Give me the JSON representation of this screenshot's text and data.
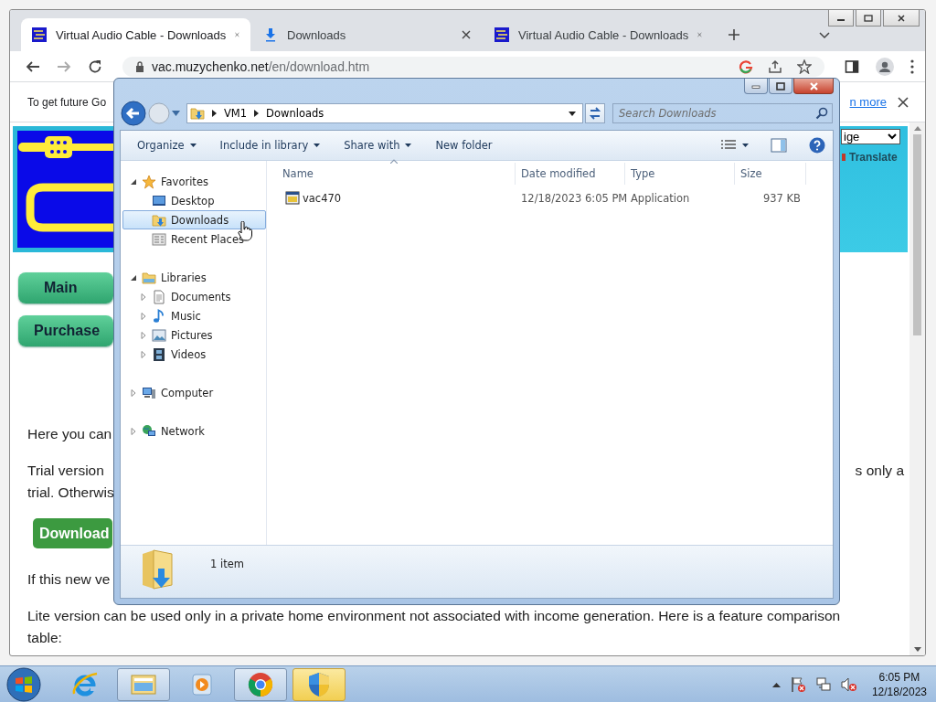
{
  "browser": {
    "tabs": [
      {
        "title": "Virtual Audio Cable - Downloads",
        "kind": "site",
        "selected": true
      },
      {
        "title": "Downloads",
        "kind": "download",
        "selected": false
      },
      {
        "title": "Virtual Audio Cable - Downloads",
        "kind": "site",
        "selected": false
      }
    ],
    "address": {
      "domain": "vac.muzychenko.net",
      "path": "/en/download.htm"
    },
    "infobar": {
      "text": "To get future Go",
      "link": "n more"
    },
    "page": {
      "language": "ige",
      "translate": "Translate",
      "nav_buttons": [
        "Main",
        "Purchase"
      ],
      "blocks": [
        {
          "kind": "text",
          "lines": [
            {
              "left": "Here you can"
            }
          ]
        },
        {
          "kind": "text",
          "lines": [
            {
              "left": "Trial version",
              "right": "s only a"
            },
            {
              "left": "trial. Otherwis"
            }
          ]
        },
        {
          "kind": "button",
          "label": "Download"
        },
        {
          "kind": "text",
          "lines": [
            {
              "left": "If this new ve"
            }
          ]
        },
        {
          "kind": "text",
          "lines": [
            {
              "left": "Lite version can be used only in a private home environment not associated with income generation. Here is a feature comparison"
            },
            {
              "left": "table:"
            }
          ]
        }
      ]
    }
  },
  "explorer": {
    "breadcrumb": [
      "VM1",
      "Downloads"
    ],
    "search": {
      "placeholder": "Search Downloads"
    },
    "toolbar": [
      {
        "label": "Organize",
        "dropdown": true
      },
      {
        "label": "Include in library",
        "dropdown": true
      },
      {
        "label": "Share with",
        "dropdown": true
      },
      {
        "label": "New folder",
        "dropdown": false
      }
    ],
    "nav": [
      {
        "label": "Favorites",
        "kind": "favorites",
        "expanded": true,
        "selected": false,
        "children": [
          {
            "label": "Desktop",
            "kind": "desktop",
            "selected": false
          },
          {
            "label": "Downloads",
            "kind": "downloads",
            "selected": true
          },
          {
            "label": "Recent Places",
            "kind": "recent",
            "selected": false
          }
        ]
      },
      {
        "label": "Libraries",
        "kind": "libraries",
        "expanded": true,
        "selected": false,
        "children": [
          {
            "label": "Documents",
            "kind": "documents",
            "expanded": false,
            "selected": false
          },
          {
            "label": "Music",
            "kind": "music",
            "expanded": false,
            "selected": false
          },
          {
            "label": "Pictures",
            "kind": "pictures",
            "expanded": false,
            "selected": false
          },
          {
            "label": "Videos",
            "kind": "videos",
            "expanded": false,
            "selected": false
          }
        ]
      },
      {
        "label": "Computer",
        "kind": "computer",
        "expanded": false,
        "selected": false
      },
      {
        "label": "Network",
        "kind": "network",
        "expanded": false,
        "selected": false
      }
    ],
    "columns": [
      {
        "label": "Name",
        "sorted": true
      },
      {
        "label": "Date modified",
        "sorted": false
      },
      {
        "label": "Type",
        "sorted": false
      },
      {
        "label": "Size",
        "sorted": false
      }
    ],
    "files": [
      {
        "name": "vac470",
        "date": "12/18/2023 6:05 PM",
        "type": "Application",
        "size": "937 KB",
        "selected": false
      }
    ],
    "status": "1 item"
  },
  "taskbar": {
    "apps": [
      {
        "kind": "ie",
        "running": false,
        "highlighted": false
      },
      {
        "kind": "explorer",
        "running": true,
        "highlighted": false
      },
      {
        "kind": "media",
        "running": false,
        "highlighted": false
      },
      {
        "kind": "chrome",
        "running": true,
        "highlighted": false
      },
      {
        "kind": "security",
        "running": true,
        "highlighted": true
      }
    ],
    "clock": {
      "time": "6:05 PM",
      "date": "12/18/2023"
    }
  }
}
